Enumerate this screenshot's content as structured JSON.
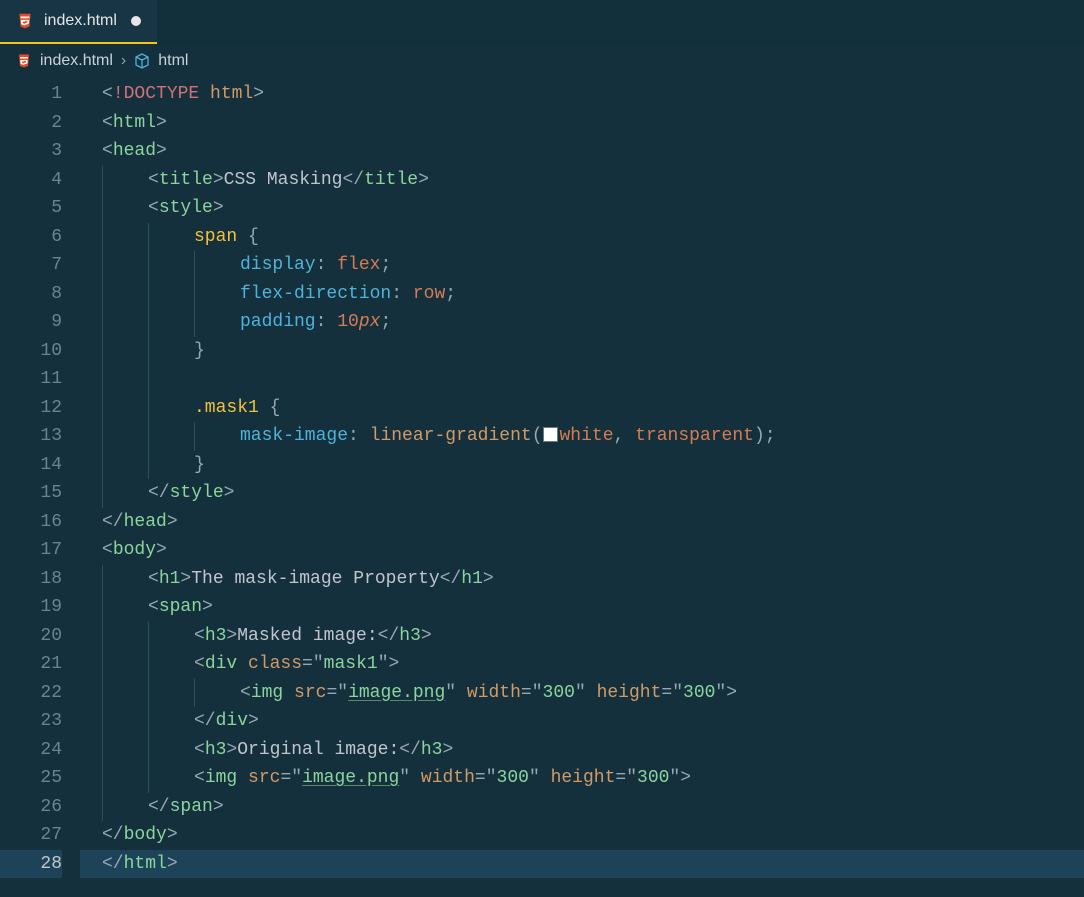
{
  "tab": {
    "filename": "index.html",
    "dirty": true
  },
  "breadcrumb": {
    "file": "index.html",
    "symbol": "html",
    "separator": "›"
  },
  "icons": {
    "html5": "html5-icon",
    "package": "package-icon"
  },
  "colors": {
    "background": "#14303d",
    "tab_active_border": "#f9c513",
    "tag": "#8bd49c",
    "attribute": "#d19a66",
    "property": "#4fb3d9",
    "value": "#d67b53",
    "selector": "#f3c13a",
    "punctuation": "#96a8b2",
    "text": "#c0c5ce"
  },
  "code": {
    "lines": [
      {
        "n": 1,
        "indent": 0,
        "tokens": [
          [
            "pn",
            "<"
          ],
          [
            "dt",
            "!DOCTYPE "
          ],
          [
            "at",
            "html"
          ],
          [
            "pn",
            ">"
          ]
        ]
      },
      {
        "n": 2,
        "indent": 0,
        "tokens": [
          [
            "pn",
            "<"
          ],
          [
            "tag",
            "html"
          ],
          [
            "pn",
            ">"
          ]
        ]
      },
      {
        "n": 3,
        "indent": 0,
        "tokens": [
          [
            "pn",
            "<"
          ],
          [
            "tag",
            "head"
          ],
          [
            "pn",
            ">"
          ]
        ]
      },
      {
        "n": 4,
        "indent": 1,
        "tokens": [
          [
            "pn",
            "<"
          ],
          [
            "tag",
            "title"
          ],
          [
            "pn",
            ">"
          ],
          [
            "txt",
            "CSS Masking"
          ],
          [
            "pn",
            "</"
          ],
          [
            "tag",
            "title"
          ],
          [
            "pn",
            ">"
          ]
        ]
      },
      {
        "n": 5,
        "indent": 1,
        "tokens": [
          [
            "pn",
            "<"
          ],
          [
            "tag",
            "style"
          ],
          [
            "pn",
            ">"
          ]
        ]
      },
      {
        "n": 6,
        "indent": 2,
        "tokens": [
          [
            "sel",
            "span"
          ],
          [
            "txt",
            " "
          ],
          [
            "pn",
            "{"
          ]
        ]
      },
      {
        "n": 7,
        "indent": 3,
        "tokens": [
          [
            "pr",
            "display"
          ],
          [
            "pn",
            ":"
          ],
          [
            "txt",
            " "
          ],
          [
            "val",
            "flex"
          ],
          [
            "pn",
            ";"
          ]
        ]
      },
      {
        "n": 8,
        "indent": 3,
        "tokens": [
          [
            "pr",
            "flex-direction"
          ],
          [
            "pn",
            ":"
          ],
          [
            "txt",
            " "
          ],
          [
            "val",
            "row"
          ],
          [
            "pn",
            ";"
          ]
        ]
      },
      {
        "n": 9,
        "indent": 3,
        "tokens": [
          [
            "pr",
            "padding"
          ],
          [
            "pn",
            ":"
          ],
          [
            "txt",
            " "
          ],
          [
            "num",
            "10"
          ],
          [
            "unit",
            "px"
          ],
          [
            "pn",
            ";"
          ]
        ]
      },
      {
        "n": 10,
        "indent": 2,
        "tokens": [
          [
            "pn",
            "}"
          ]
        ]
      },
      {
        "n": 11,
        "indent": 2,
        "tokens": []
      },
      {
        "n": 12,
        "indent": 2,
        "tokens": [
          [
            "cls",
            ".mask1"
          ],
          [
            "txt",
            " "
          ],
          [
            "pn",
            "{"
          ]
        ]
      },
      {
        "n": 13,
        "indent": 3,
        "tokens": [
          [
            "pr",
            "mask-image"
          ],
          [
            "pn",
            ":"
          ],
          [
            "txt",
            " "
          ],
          [
            "fn",
            "linear-gradient"
          ],
          [
            "pn",
            "("
          ],
          [
            "swatch",
            ""
          ],
          [
            "val",
            "white"
          ],
          [
            "pn",
            ","
          ],
          [
            "txt",
            " "
          ],
          [
            "val",
            "transparent"
          ],
          [
            "pn",
            ")"
          ],
          [
            "pn",
            ";"
          ]
        ]
      },
      {
        "n": 14,
        "indent": 2,
        "tokens": [
          [
            "pn",
            "}"
          ]
        ]
      },
      {
        "n": 15,
        "indent": 1,
        "tokens": [
          [
            "pn",
            "</"
          ],
          [
            "tag",
            "style"
          ],
          [
            "pn",
            ">"
          ]
        ]
      },
      {
        "n": 16,
        "indent": 0,
        "tokens": [
          [
            "pn",
            "</"
          ],
          [
            "tag",
            "head"
          ],
          [
            "pn",
            ">"
          ]
        ]
      },
      {
        "n": 17,
        "indent": 0,
        "tokens": [
          [
            "pn",
            "<"
          ],
          [
            "tag",
            "body"
          ],
          [
            "pn",
            ">"
          ]
        ]
      },
      {
        "n": 18,
        "indent": 1,
        "tokens": [
          [
            "pn",
            "<"
          ],
          [
            "tag",
            "h1"
          ],
          [
            "pn",
            ">"
          ],
          [
            "txt",
            "The mask-image Property"
          ],
          [
            "pn",
            "</"
          ],
          [
            "tag",
            "h1"
          ],
          [
            "pn",
            ">"
          ]
        ]
      },
      {
        "n": 19,
        "indent": 1,
        "tokens": [
          [
            "pn",
            "<"
          ],
          [
            "tag",
            "span"
          ],
          [
            "pn",
            ">"
          ]
        ]
      },
      {
        "n": 20,
        "indent": 2,
        "tokens": [
          [
            "pn",
            "<"
          ],
          [
            "tag",
            "h3"
          ],
          [
            "pn",
            ">"
          ],
          [
            "txt",
            "Masked image:"
          ],
          [
            "pn",
            "</"
          ],
          [
            "tag",
            "h3"
          ],
          [
            "pn",
            ">"
          ]
        ]
      },
      {
        "n": 21,
        "indent": 2,
        "tokens": [
          [
            "pn",
            "<"
          ],
          [
            "tag",
            "div"
          ],
          [
            "txt",
            " "
          ],
          [
            "at",
            "class"
          ],
          [
            "pn",
            "="
          ],
          [
            "pn",
            "\""
          ],
          [
            "str",
            "mask1"
          ],
          [
            "pn",
            "\""
          ],
          [
            "pn",
            ">"
          ]
        ]
      },
      {
        "n": 22,
        "indent": 3,
        "tokens": [
          [
            "pn",
            "<"
          ],
          [
            "tag",
            "img"
          ],
          [
            "txt",
            " "
          ],
          [
            "at",
            "src"
          ],
          [
            "pn",
            "="
          ],
          [
            "pn",
            "\""
          ],
          [
            "link",
            "image.png"
          ],
          [
            "pn",
            "\""
          ],
          [
            "txt",
            " "
          ],
          [
            "at",
            "width"
          ],
          [
            "pn",
            "="
          ],
          [
            "pn",
            "\""
          ],
          [
            "str",
            "300"
          ],
          [
            "pn",
            "\""
          ],
          [
            "txt",
            " "
          ],
          [
            "at",
            "height"
          ],
          [
            "pn",
            "="
          ],
          [
            "pn",
            "\""
          ],
          [
            "str",
            "300"
          ],
          [
            "pn",
            "\""
          ],
          [
            "pn",
            ">"
          ]
        ]
      },
      {
        "n": 23,
        "indent": 2,
        "tokens": [
          [
            "pn",
            "</"
          ],
          [
            "tag",
            "div"
          ],
          [
            "pn",
            ">"
          ]
        ]
      },
      {
        "n": 24,
        "indent": 2,
        "tokens": [
          [
            "pn",
            "<"
          ],
          [
            "tag",
            "h3"
          ],
          [
            "pn",
            ">"
          ],
          [
            "txt",
            "Original image:"
          ],
          [
            "pn",
            "</"
          ],
          [
            "tag",
            "h3"
          ],
          [
            "pn",
            ">"
          ]
        ]
      },
      {
        "n": 25,
        "indent": 2,
        "tokens": [
          [
            "pn",
            "<"
          ],
          [
            "tag",
            "img"
          ],
          [
            "txt",
            " "
          ],
          [
            "at",
            "src"
          ],
          [
            "pn",
            "="
          ],
          [
            "pn",
            "\""
          ],
          [
            "link",
            "image.png"
          ],
          [
            "pn",
            "\""
          ],
          [
            "txt",
            " "
          ],
          [
            "at",
            "width"
          ],
          [
            "pn",
            "="
          ],
          [
            "pn",
            "\""
          ],
          [
            "str",
            "300"
          ],
          [
            "pn",
            "\""
          ],
          [
            "txt",
            " "
          ],
          [
            "at",
            "height"
          ],
          [
            "pn",
            "="
          ],
          [
            "pn",
            "\""
          ],
          [
            "str",
            "300"
          ],
          [
            "pn",
            "\""
          ],
          [
            "pn",
            ">"
          ]
        ]
      },
      {
        "n": 26,
        "indent": 1,
        "tokens": [
          [
            "pn",
            "</"
          ],
          [
            "tag",
            "span"
          ],
          [
            "pn",
            ">"
          ]
        ]
      },
      {
        "n": 27,
        "indent": 0,
        "tokens": [
          [
            "pn",
            "</"
          ],
          [
            "tag",
            "body"
          ],
          [
            "pn",
            ">"
          ]
        ]
      },
      {
        "n": 28,
        "indent": 0,
        "current": true,
        "tokens": [
          [
            "pn",
            "</"
          ],
          [
            "tag",
            "html"
          ],
          [
            "pn",
            ">"
          ]
        ]
      }
    ]
  }
}
